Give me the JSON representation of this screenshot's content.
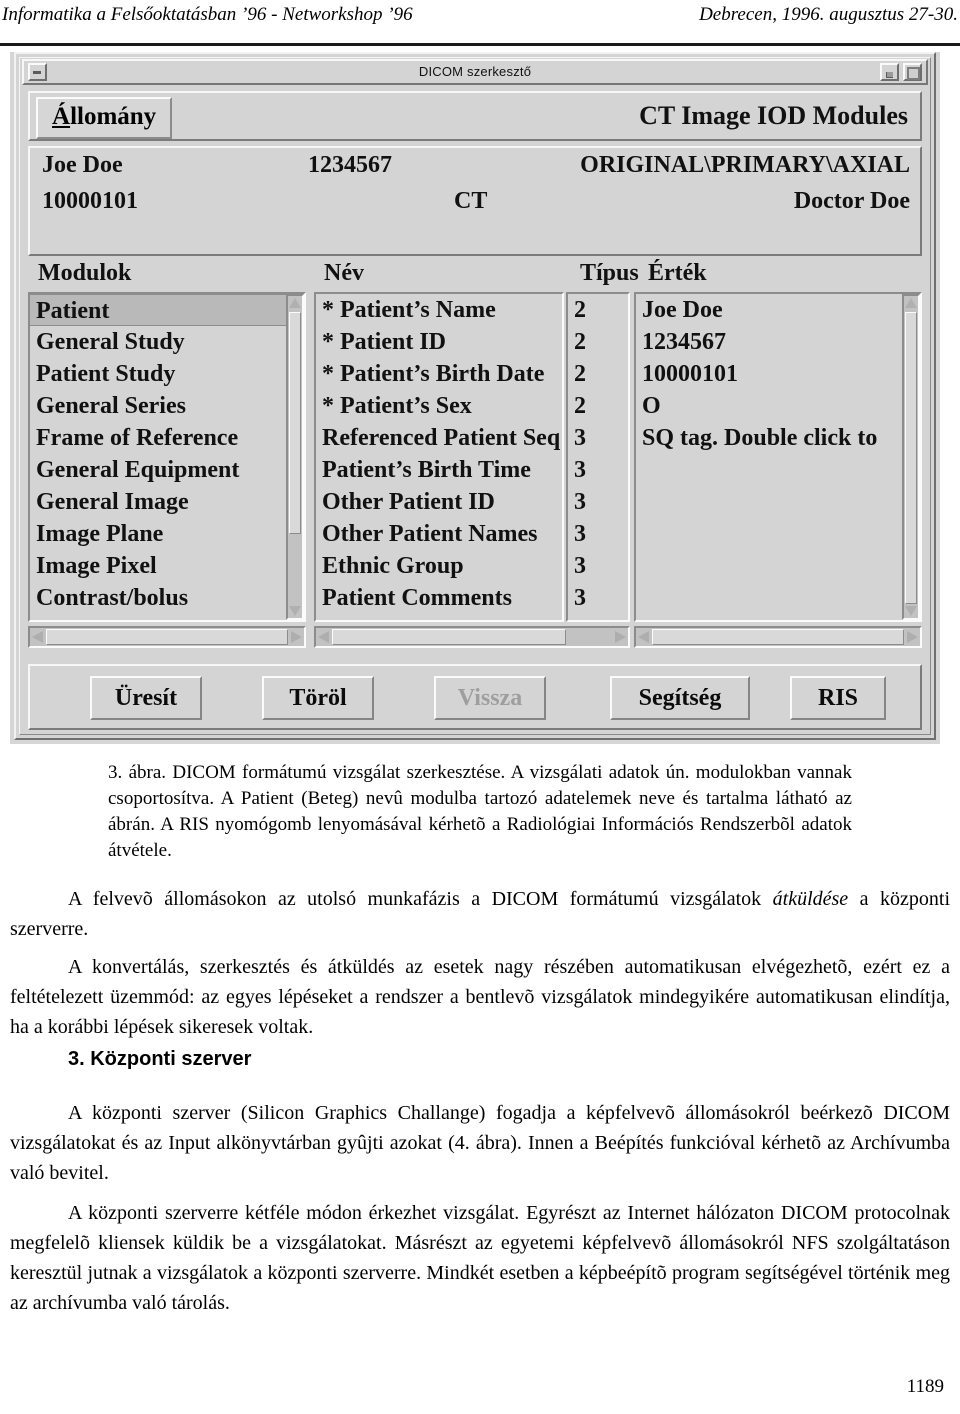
{
  "running_head": {
    "left": "Informatika a Felsőoktatásban ’96 - Networkshop ’96",
    "right": "Debrecen, 1996. augusztus 27-30."
  },
  "window": {
    "title": "DICOM szerkesztő",
    "menu": {
      "file_label": "Állomány",
      "file_mnemonic": "Á",
      "file_rest": "llomány"
    },
    "iod_title": "CT Image IOD Modules",
    "info": {
      "patient_name": "Joe Doe",
      "patient_id": "1234567",
      "image_type": "ORIGINAL\\PRIMARY\\AXIAL",
      "birth_date": "10000101",
      "modality": "CT",
      "physician": "Doctor Doe"
    },
    "columns": {
      "modules": "Modulok",
      "name": "Név",
      "type": "Típus",
      "value": "Érték"
    },
    "modules_list": [
      {
        "label": "Patient",
        "selected": true
      },
      {
        "label": "General Study",
        "selected": false
      },
      {
        "label": "Patient Study",
        "selected": false
      },
      {
        "label": "General Series",
        "selected": false
      },
      {
        "label": "Frame of Reference",
        "selected": false
      },
      {
        "label": "General Equipment",
        "selected": false
      },
      {
        "label": "General Image",
        "selected": false
      },
      {
        "label": "Image Plane",
        "selected": false
      },
      {
        "label": "Image Pixel",
        "selected": false
      },
      {
        "label": "Contrast/bolus",
        "selected": false
      }
    ],
    "attributes": [
      {
        "name": "* Patient’s Name",
        "type": "2",
        "value": "Joe Doe"
      },
      {
        "name": "* Patient ID",
        "type": "2",
        "value": "1234567"
      },
      {
        "name": "* Patient’s Birth Date",
        "type": "2",
        "value": "10000101"
      },
      {
        "name": "* Patient’s Sex",
        "type": "2",
        "value": "O"
      },
      {
        "name": "Referenced Patient Seq",
        "type": "3",
        "value": "SQ tag. Double click to"
      },
      {
        "name": "Patient’s Birth Time",
        "type": "3",
        "value": ""
      },
      {
        "name": "Other Patient ID",
        "type": "3",
        "value": ""
      },
      {
        "name": "Other Patient Names",
        "type": "3",
        "value": ""
      },
      {
        "name": "Ethnic Group",
        "type": "3",
        "value": ""
      },
      {
        "name": "Patient Comments",
        "type": "3",
        "value": ""
      }
    ],
    "buttons": [
      {
        "label": "Üresít",
        "disabled": false
      },
      {
        "label": "Töröl",
        "disabled": false
      },
      {
        "label": "Vissza",
        "disabled": true
      },
      {
        "label": "Segítség",
        "disabled": false
      },
      {
        "label": "RIS",
        "disabled": false
      }
    ]
  },
  "text": {
    "caption": "3. ábra. DICOM formátumú vizsgálat szerkesztése. A vizsgálati adatok ún. modulokban vannak csoportosítva. A Patient (Beteg) nevû modulba tartozó adatelemek neve és tartalma látható az ábrán. A RIS nyomógomb lenyomásával kérhetõ a Radiológiai Információs Rendszerbõl adatok átvétele.",
    "p1_a": "A felvevõ állomásokon az utolsó munkafázis a DICOM formátumú vizsgálatok ",
    "p1_em": "átküldése",
    "p1_b": " a központi szerverre.",
    "p2": "A konvertálás, szerkesztés és átküldés az esetek nagy részében automatikusan elvégezhetõ, ezért ez a feltételezett üzemmód: az egyes lépéseket a rendszer a bentlevõ vizsgálatok mindegyikére automatikusan elindítja, ha a korábbi lépések sikeresek voltak.",
    "section_heading": "3. Központi szerver",
    "p3": "A központi szerver (Silicon Graphics Challange) fogadja a képfelvevõ állomásokról beérkezõ DICOM vizsgálatokat és az Input alkönyvtárban gyûjti azokat (4. ábra). Innen a Beépítés funkcióval kérhetõ az Archívumba való bevitel.",
    "p4": "A központi szerverre kétféle módon érkezhet vizsgálat. Egyrészt az Internet hálózaton DICOM protocolnak megfelelõ kliensek küldik be a vizsgálatokat. Másrészt az egyetemi képfelvevõ állomásokról NFS szolgáltatáson keresztül jutnak a vizsgálatok a központi szerverre. Mindkét esetben a képbeépítõ program segítségével történik meg az archívumba való tárolás.",
    "page_number": "1189"
  }
}
